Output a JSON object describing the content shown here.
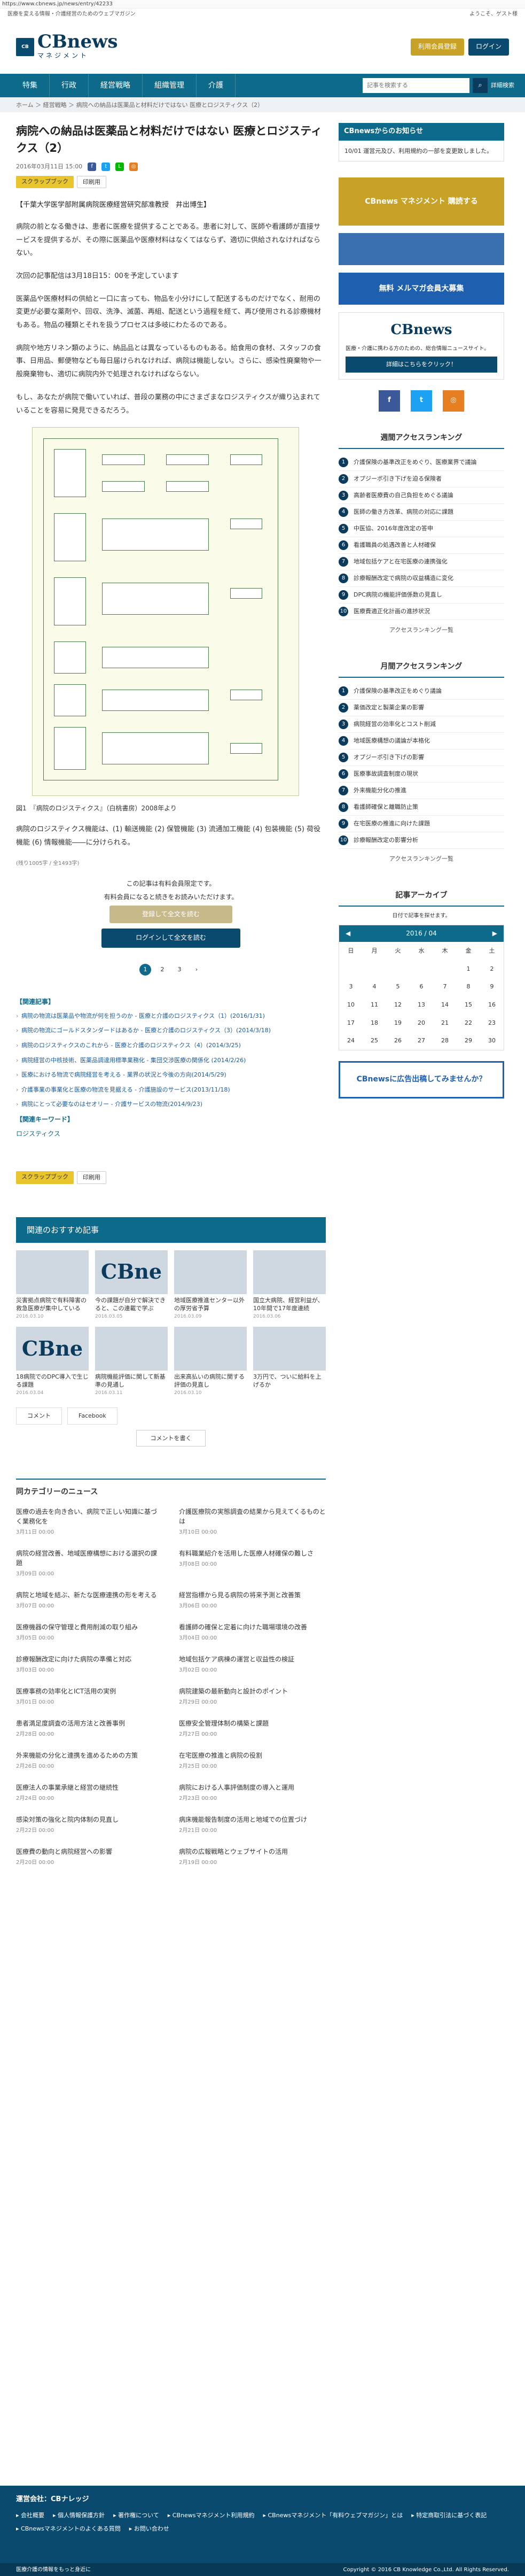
{
  "browser": {
    "url": "https://www.cbnews.jp/news/entry/42233"
  },
  "top": {
    "tagline": "医療を変える情報・介護経営のためのウェブマガジン",
    "welcome": "ようこそ、ゲスト様"
  },
  "logo": {
    "mark": "CB",
    "name": "CBnews",
    "sub": "マネジメント"
  },
  "header": {
    "register": "利用会員登録",
    "login": "ログイン"
  },
  "nav": {
    "items": [
      "特集",
      "行政",
      "経営戦略",
      "組織管理",
      "介護"
    ],
    "search_placeholder": "記事を検索する",
    "advanced": "詳細検索"
  },
  "breadcrumb": "ホーム ＞ 経営戦略 ＞ 病院への納品は医薬品と材料だけではない 医療とロジスティクス（2）",
  "article": {
    "title": "病院への納品は医薬品と材料だけではない 医療とロジスティクス（2）",
    "date": "2016年03月11日 15:00",
    "tag_scrap": "スクラップブック",
    "tag_print": "印刷用",
    "author": "【千葉大学医学部附属病院医療経営研究部准教授　井出博生】",
    "p1": "病院の前となる働きは、患者に医療を提供することである。患者に対して、医師や看護師が直接サービスを提供するが、その際に医薬品や医療材料はなくてはならず、適切に供給されなければならない。",
    "p2": "次回の記事配信は3月18日15：00を予定しています",
    "p3": "医薬品や医療材料の供給と一口に言っても、物品を小分けにして配送するものだけでなく、耐用の変更が必要な薬剤や、回収、洗浄、滅菌、再組、配送という過程を経て、再び使用される診療機材もある。物品の種類とそれを扱うプロセスは多岐にわたるのである。",
    "p4": "病院や地方リネン類のように、納品品とは異なっているものもある。給食用の食材、スタッフの食事、日用品、郵便物なども毎日届けられなければ、病院は機能しない。さらに、感染性廃棄物や一般廃棄物も、適切に病院内外で処理されなければならない。",
    "p5": "もし、あなたが病院で働いていれば、普段の業務の中にさまざまなロジスティクスが織り込まれていることを容易に発見できるだろう。",
    "caption": "図1　『病院のロジスティクス』（白桃書房）2008年より",
    "p6": "病院のロジスティクス機能は、(1) 輸送機能 (2) 保管機能 (3) 流通加工機能 (4) 包装機能 (5) 荷役機能 (6) 情報機能――に分けられる。",
    "notes": "(残り1005字 / 全1493字)",
    "lock1": "この記事は有料会員限定です。",
    "lock2": "有料会員になると続きをお読みいただけます。",
    "lock_btn1": "登録して全文を読む",
    "lock_btn2": "ログインして全文を読む",
    "pages": [
      "1",
      "2",
      "3"
    ],
    "rel_title": "【関連記事】",
    "related": [
      "病院の物流は医薬品や物流が何を担うのか - 医療と介護のロジスティクス（1）(2016/1/31)",
      "病院の物流にゴールドスタンダードはあるか - 医療と介護のロジスティクス（3）(2014/3/18)",
      "病院のロジスティクスのこれから - 医療と介護のロジスティクス（4）(2014/3/25)",
      "病院経営の中核技術、医薬品調達用標準業務化 - 集団交渉医療の関係化 (2014/2/26)",
      "医療における物流で病院経営を考える - 業界の状況と今後の方向(2014/5/29)",
      "介護事業の事業化と医療の物流を見据える - 介護施設のサービス(2013/11/18)",
      "病院にとって必要なのはセオリー - 介護サービスの物流(2014/9/23)"
    ],
    "kw_title": "【関連キーワード】",
    "kw": "ロジスティクス"
  },
  "recommend": {
    "title": "関連のおすすめ記事",
    "cards": [
      {
        "t": "災害拠点病院で有料障害の救急医療が集中している",
        "d": "2016.03.10",
        "thumb": ""
      },
      {
        "t": "今の課題が自分で解決できると、この連載で学ぶ",
        "d": "2016.03.05",
        "thumb": "CBne"
      },
      {
        "t": "地域医療推進センター以外の厚労省予算",
        "d": "2016.03.09",
        "thumb": ""
      },
      {
        "t": "国立大病院、経営利益が、10年間で17年度連続",
        "d": "2016.03.06",
        "thumb": ""
      },
      {
        "t": "18病院でのDPC導入で生じる課題",
        "d": "2016.03.04",
        "thumb": "CBne"
      },
      {
        "t": "病院機能評価に関して新基準の見通し",
        "d": "2016.03.11",
        "thumb": ""
      },
      {
        "t": "出来高払いの病院に関する評価の見直し",
        "d": "2016.03.10",
        "thumb": ""
      },
      {
        "t": "3万円で、ついに給料を上げるか",
        "d": "",
        "thumb": ""
      }
    ],
    "cm_label": "コメント",
    "fb_label": "Facebook",
    "cmt_btn": "コメントを書く"
  },
  "rcat": {
    "title": "同カテゴリーのニュース",
    "items": [
      {
        "t": "医療の過去を向き合い、病院で正しい知識に基づく業務化を",
        "d": "3月11日 00:00"
      },
      {
        "t": "介護医療院の実態調査の結果から見えてくるものとは",
        "d": "3月10日 00:00"
      },
      {
        "t": "病院の経営改善、地域医療構想における選択の課題",
        "d": "3月09日 00:00"
      },
      {
        "t": "有料職業紹介を活用した医療人材確保の難しさ",
        "d": "3月08日 00:00"
      },
      {
        "t": "病院と地域を結ぶ、新たな医療連携の形を考える",
        "d": "3月07日 00:00"
      },
      {
        "t": "経営指標から見る病院の将来予測と改善策",
        "d": "3月06日 00:00"
      },
      {
        "t": "医療機器の保守管理と費用削減の取り組み",
        "d": "3月05日 00:00"
      },
      {
        "t": "看護師の確保と定着に向けた職場環境の改善",
        "d": "3月04日 00:00"
      },
      {
        "t": "診療報酬改定に向けた病院の準備と対応",
        "d": "3月03日 00:00"
      },
      {
        "t": "地域包括ケア病棟の運営と収益性の検証",
        "d": "3月02日 00:00"
      },
      {
        "t": "医療事務の効率化とICT活用の実例",
        "d": "3月01日 00:00"
      },
      {
        "t": "病院建築の最新動向と設計のポイント",
        "d": "2月29日 00:00"
      },
      {
        "t": "患者満足度調査の活用方法と改善事例",
        "d": "2月28日 00:00"
      },
      {
        "t": "医療安全管理体制の構築と課題",
        "d": "2月27日 00:00"
      },
      {
        "t": "外来機能の分化と連携を進めるための方策",
        "d": "2月26日 00:00"
      },
      {
        "t": "在宅医療の推進と病院の役割",
        "d": "2月25日 00:00"
      },
      {
        "t": "医療法人の事業承継と経営の継続性",
        "d": "2月24日 00:00"
      },
      {
        "t": "病院における人事評価制度の導入と運用",
        "d": "2月23日 00:00"
      },
      {
        "t": "感染対策の強化と院内体制の見直し",
        "d": "2月22日 00:00"
      },
      {
        "t": "病床機能報告制度の活用と地域での位置づけ",
        "d": "2月21日 00:00"
      },
      {
        "t": "医療費の動向と病院経営への影響",
        "d": "2月20日 00:00"
      },
      {
        "t": "病院の広報戦略とウェブサイトの活用",
        "d": "2月19日 00:00"
      }
    ]
  },
  "side": {
    "notice_title": "CBnewsからのお知らせ",
    "notice": "10/01 運営元及び、利用規約の一部を変更致しました。",
    "ad1": "CBnews マネジメント 購読する",
    "ad2": "無料 メルマガ会員大募集",
    "logo2": "CBnews",
    "logo2_text": "医療・介護に携わる方のための、総合情報ニュースサイト。",
    "detail_btn": "詳細はこちらをクリック！",
    "rank_week": "週間アクセスランキング",
    "week": [
      "介護保険の基準改正をめぐり、医療業界で議論",
      "オプジーボ引き下げを迫る保険者",
      "高齢者医療費の自己負担をめぐる議論",
      "医師の働き方改革、病院の対応に課題",
      "中医協、2016年度改定の答申",
      "看護職員の処遇改善と人材確保",
      "地域包括ケアと在宅医療の連携強化",
      "診療報酬改定で病院の収益構造に変化",
      "DPC病院の機能評価係数の見直し",
      "医療費適正化計画の進捗状況"
    ],
    "week_more": "アクセスランキング一覧",
    "rank_month": "月間アクセスランキング",
    "month": [
      "介護保険の基準改正をめぐり議論",
      "薬価改定と製薬企業の影響",
      "病院経営の効率化とコスト削減",
      "地域医療構想の議論が本格化",
      "オプジーボ引き下げの影響",
      "医療事故調査制度の現状",
      "外来機能分化の推進",
      "看護師確保と離職防止策",
      "在宅医療の推進に向けた課題",
      "診療報酬改定の影響分析"
    ],
    "month_more": "アクセスランキング一覧",
    "archive_title": "記事アーカイブ",
    "archive_sub": "日付で記事を探せます。",
    "month_label": "2016 / 04",
    "days": [
      "日",
      "月",
      "火",
      "水",
      "木",
      "金",
      "土"
    ],
    "cal": [
      [
        "",
        "",
        "",
        "",
        "",
        "1",
        "2"
      ],
      [
        "3",
        "4",
        "5",
        "6",
        "7",
        "8",
        "9"
      ],
      [
        "10",
        "11",
        "12",
        "13",
        "14",
        "15",
        "16"
      ],
      [
        "17",
        "18",
        "19",
        "20",
        "21",
        "22",
        "23"
      ],
      [
        "24",
        "25",
        "26",
        "27",
        "28",
        "29",
        "30"
      ]
    ],
    "ad3": "CBnewsに広告出稿してみませんか？"
  },
  "footer": {
    "title": "運営会社：CBナレッジ",
    "links": [
      "会社概要",
      "個人情報保護方針",
      "著作権について",
      "CBnewsマネジメント利用規約",
      "CBnewsマネジメント「有料ウェブマガジン」とは",
      "特定商取引法に基づく表記",
      "CBnewsマネジメントのよくある質問",
      "お問い合わせ"
    ],
    "left": "医療介護の情報をもっと身近に",
    "copyright": "Copyright © 2016 CB Knowledge Co.,Ltd. All Rights Reserved."
  }
}
